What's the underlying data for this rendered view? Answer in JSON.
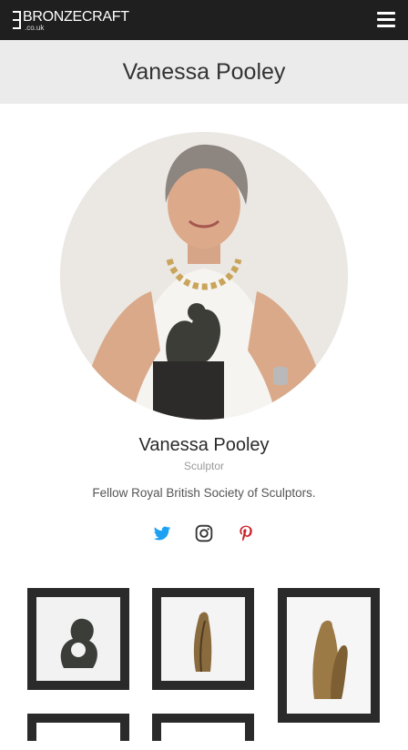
{
  "header": {
    "logo_text": "BRONZECRAFT",
    "logo_sub": ".co.uk",
    "menu_icon": "hamburger-menu-icon"
  },
  "page": {
    "title": "Vanessa Pooley"
  },
  "profile": {
    "name": "Vanessa Pooley",
    "role": "Sculptor",
    "bio": "Fellow Royal British Society of Sculptors."
  },
  "social": [
    {
      "icon": "twitter-icon",
      "color": "#1da1f2"
    },
    {
      "icon": "instagram-icon",
      "color": "#333333"
    },
    {
      "icon": "pinterest-icon",
      "color": "#cb2027"
    }
  ],
  "gallery": {
    "item_count_visible": 6
  },
  "colors": {
    "topbar": "#1f1f1f",
    "title_band": "#ebebeb",
    "frame": "#2a2a2a"
  }
}
